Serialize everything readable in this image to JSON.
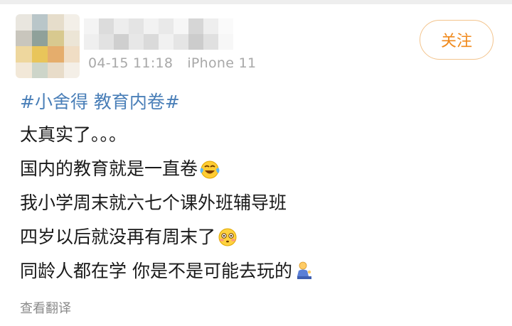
{
  "post": {
    "timestamp": "04-15 11:18",
    "device": "iPhone 11",
    "follow_label": "关注",
    "hashtag": "#小舍得 教育内卷#",
    "lines": [
      "太真实了。。。",
      "国内的教育就是一直卷",
      "我小学周末就六七个课外班辅导班",
      "四岁以后就没再有周末了",
      "同龄人都在学 你是不是可能去玩的"
    ],
    "emojis": [
      "laugh-cry-emoji",
      "flushed-face-emoji",
      "kneeling-person-emoji"
    ],
    "translate_label": "查看翻译"
  },
  "colors": {
    "hashtag": "#4a7fb8",
    "follow_text": "#f08a1d",
    "follow_border": "#f3c48d",
    "meta_text": "#a8a8a8",
    "body_text": "#1a1a1a"
  }
}
